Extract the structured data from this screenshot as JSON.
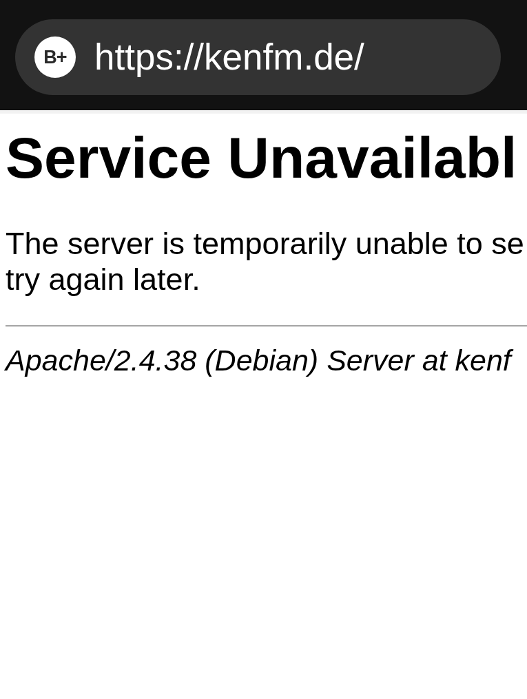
{
  "address_bar": {
    "badge": "B+",
    "url": "https://kenfm.de/"
  },
  "page": {
    "heading": "Service Unavailabl",
    "message_lines": [
      "The server is temporarily unable to se",
      "try again later."
    ],
    "footer": "Apache/2.4.38 (Debian) Server at kenf"
  }
}
